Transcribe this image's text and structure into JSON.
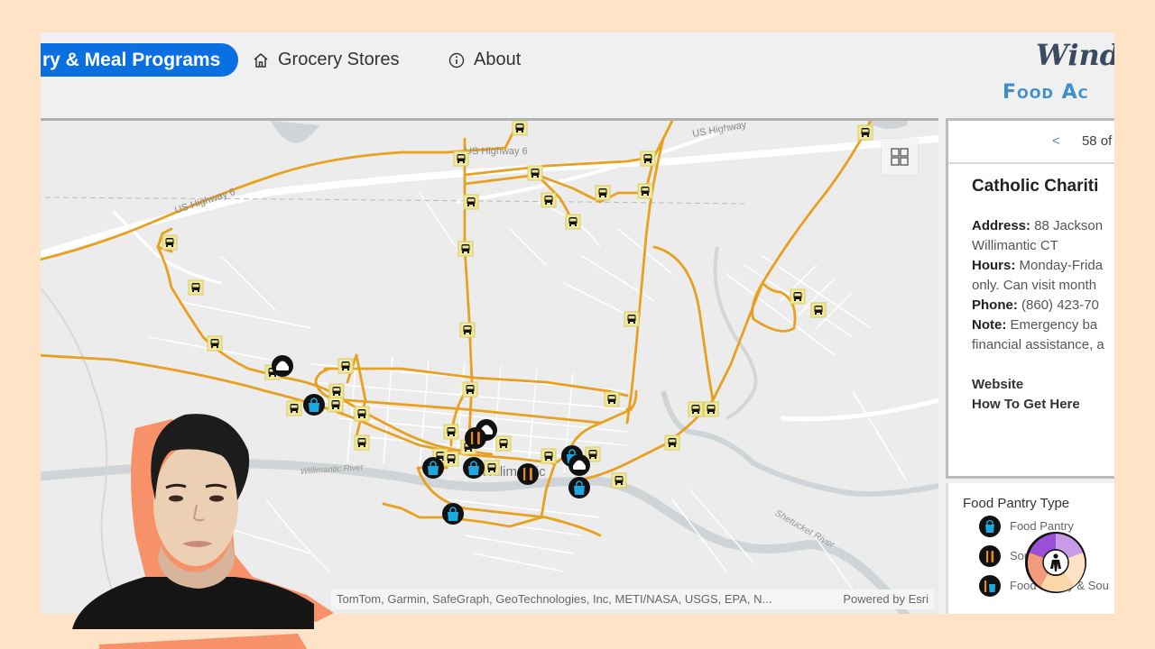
{
  "nav": {
    "active_tab": "ry & Meal Programs",
    "tabs": [
      {
        "label": "Grocery Stores",
        "icon": "home-icon"
      },
      {
        "label": "About",
        "icon": "info-icon"
      }
    ]
  },
  "logo": {
    "line1": "Windh",
    "line2": "Food Ac"
  },
  "map": {
    "labels": {
      "hwy1": "US Highway 6",
      "hwy2": "US Highway 6",
      "hwy3": "US Highway",
      "river1": "Willimantic River",
      "river2": "Shetucket River",
      "town": "Willimantic"
    },
    "attribution": "TomTom, Garmin, SafeGraph, GeoTechnologies, Inc, METI/NASA, USGS, EPA, N...",
    "powered_by": "Powered by Esri",
    "colors": {
      "bus_route": "#e8a020",
      "bus_stop_bg": "#f0e89a",
      "pantry": "#1ea8e0",
      "soup": "#e88a1a"
    }
  },
  "popup": {
    "prev": "<",
    "pager": "58 of",
    "title": "Catholic Chariti",
    "address_label": "Address:",
    "address_value": " 88 Jackson",
    "address_line2": "Willimantic CT",
    "hours_label": "Hours:",
    "hours_value": " Monday-Frida",
    "hours_line2": "only. Can visit month",
    "phone_label": "Phone:",
    "phone_value": " (860) 423-70",
    "note_label": "Note:",
    "note_value": " Emergency ba",
    "note_line2": "financial assistance, a",
    "website": "Website",
    "directions": "How To Get Here"
  },
  "legend": {
    "title": "Food Pantry Type",
    "items": [
      {
        "label": "Food Pantry",
        "icon": "food-pantry-bag-icon"
      },
      {
        "label": "Soup Kitchen",
        "icon": "soup-kitchen-utensils-icon"
      },
      {
        "label": "Food Pantry & Sou",
        "icon": "pantry-and-soup-icon"
      }
    ]
  }
}
